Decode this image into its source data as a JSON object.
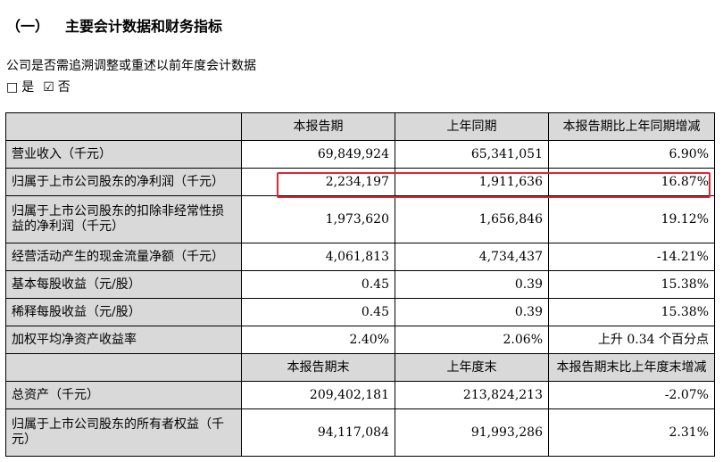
{
  "heading": {
    "num": "（一）",
    "title": "主要会计数据和财务指标"
  },
  "restate_note": "公司是否需追溯调整或重述以前年度会计数据",
  "choices": {
    "yes_box": "□",
    "yes_label": "是",
    "no_box": "☑",
    "no_label": "否"
  },
  "table": {
    "header1": [
      "本报告期",
      "上年同期",
      "本报告期比上年同期增减"
    ],
    "rows1": [
      {
        "label": "营业收入（千元）",
        "cur": "69,849,924",
        "prev": "65,341,051",
        "change": "6.90%"
      },
      {
        "label": "归属于上市公司股东的净利润（千元）",
        "cur": "2,234,197",
        "prev": "1,911,636",
        "change": "16.87%"
      },
      {
        "label": "归属于上市公司股东的扣除非经常性损益的净利润（千元）",
        "cur": "1,973,620",
        "prev": "1,656,846",
        "change": "19.12%"
      },
      {
        "label": "经营活动产生的现金流量净额（千元）",
        "cur": "4,061,813",
        "prev": "4,734,437",
        "change": "-14.21%"
      },
      {
        "label": "基本每股收益（元/股）",
        "cur": "0.45",
        "prev": "0.39",
        "change": "15.38%"
      },
      {
        "label": "稀释每股收益（元/股）",
        "cur": "0.45",
        "prev": "0.39",
        "change": "15.38%"
      },
      {
        "label": "加权平均净资产收益率",
        "cur": "2.40%",
        "prev": "2.06%",
        "change": "上升 0.34 个百分点"
      }
    ],
    "header2": [
      "本报告期末",
      "上年度末",
      "本报告期末比上年度末增减"
    ],
    "rows2": [
      {
        "label": "总资产（千元）",
        "cur": "209,402,181",
        "prev": "213,824,213",
        "change": "-2.07%"
      },
      {
        "label": "归属于上市公司股东的所有者权益（千元）",
        "cur": "94,117,084",
        "prev": "91,993,286",
        "change": "2.31%"
      }
    ]
  }
}
